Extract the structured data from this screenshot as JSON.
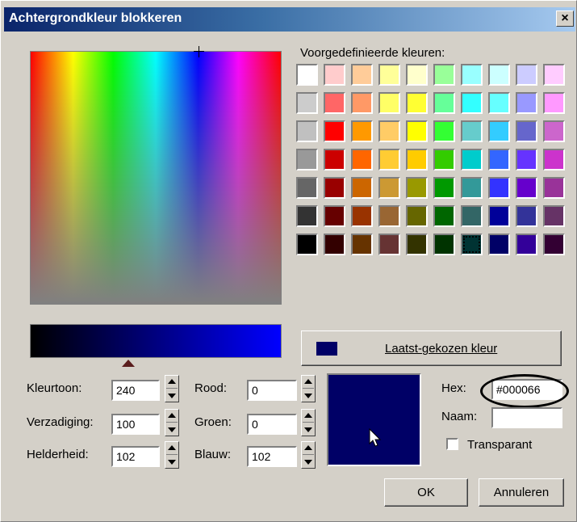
{
  "window": {
    "title": "Achtergrondkleur blokkeren",
    "close_label": "×"
  },
  "palette": {
    "label": "Voorgedefinieerde kleuren:",
    "rows": [
      [
        "#ffffff",
        "#ffcccc",
        "#ffcc99",
        "#ffff99",
        "#ffffcc",
        "#99ff99",
        "#99ffff",
        "#ccffff",
        "#ccccff",
        "#ffccff"
      ],
      [
        "#cccccc",
        "#ff6666",
        "#ff9966",
        "#ffff66",
        "#ffff33",
        "#66ff99",
        "#33ffff",
        "#66ffff",
        "#9999ff",
        "#ff99ff"
      ],
      [
        "#c0c0c0",
        "#ff0000",
        "#ff9900",
        "#ffcc66",
        "#ffff00",
        "#33ff33",
        "#66cccc",
        "#33ccff",
        "#6666cc",
        "#cc66cc"
      ],
      [
        "#999999",
        "#cc0000",
        "#ff6600",
        "#ffcc33",
        "#ffcc00",
        "#33cc00",
        "#00cccc",
        "#3366ff",
        "#6633ff",
        "#cc33cc"
      ],
      [
        "#666666",
        "#990000",
        "#cc6600",
        "#cc9933",
        "#999900",
        "#009900",
        "#339999",
        "#3333ff",
        "#6600cc",
        "#993399"
      ],
      [
        "#333333",
        "#660000",
        "#993300",
        "#996633",
        "#666600",
        "#006600",
        "#336666",
        "#000099",
        "#333399",
        "#663366"
      ],
      [
        "#000000",
        "#330000",
        "#663300",
        "#663333",
        "#333300",
        "#003300",
        "#003333",
        "#000066",
        "#330099",
        "#330033"
      ]
    ],
    "selected": {
      "row": 6,
      "col": 6
    }
  },
  "fields": {
    "hue": {
      "label": "Kleurtoon:",
      "value": "240"
    },
    "saturation": {
      "label": "Verzadiging:",
      "value": "100"
    },
    "brightness": {
      "label": "Helderheid:",
      "value": "102"
    },
    "red": {
      "label": "Rood:",
      "value": "0"
    },
    "green": {
      "label": "Groen:",
      "value": "0"
    },
    "blue": {
      "label": "Blauw:",
      "value": "102"
    },
    "hex": {
      "label": "Hex:",
      "value": "#000066"
    },
    "name": {
      "label": "Naam:",
      "value": ""
    }
  },
  "last_color": {
    "label": "Laatst-gekozen kleur",
    "swatch": "#000066"
  },
  "preview_color": "#000066",
  "transparent": {
    "label": "Transparant",
    "checked": false
  },
  "buttons": {
    "ok": "OK",
    "cancel": "Annuleren"
  }
}
